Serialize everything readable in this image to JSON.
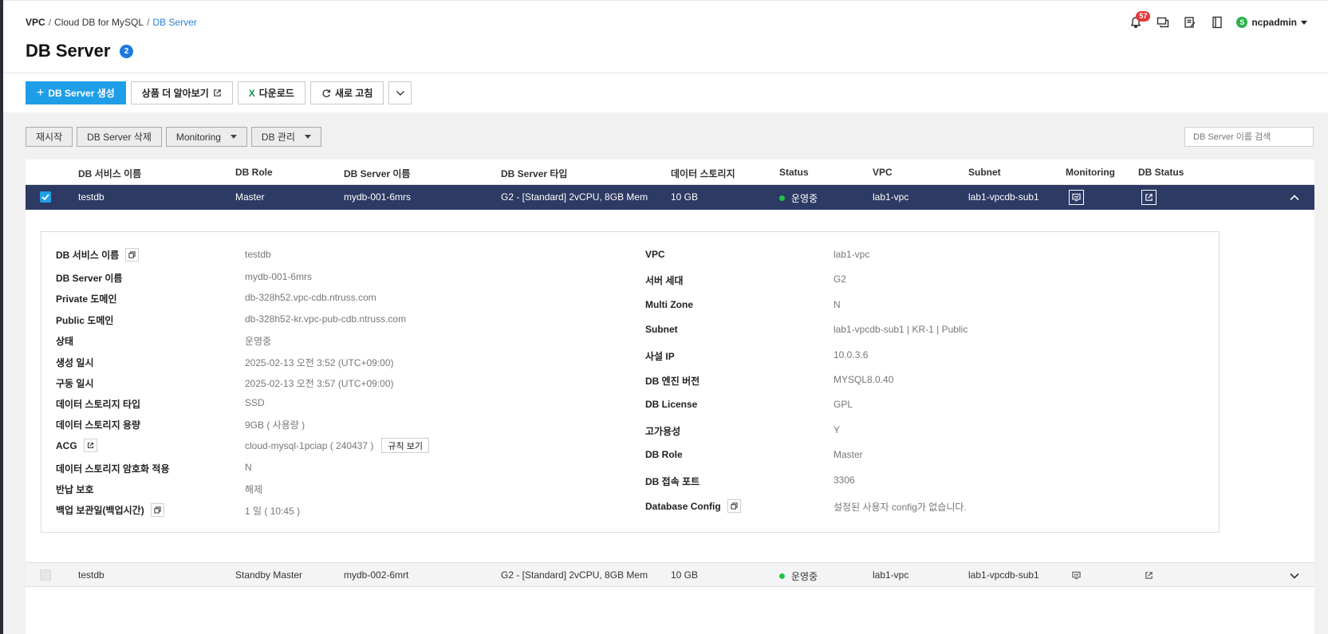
{
  "breadcrumb": {
    "root": "VPC",
    "sep": "/",
    "mid": "Cloud DB for MySQL",
    "current": "DB Server"
  },
  "page": {
    "title": "DB Server",
    "count": "2"
  },
  "topbar": {
    "notification_count": "57",
    "user_initial": "S",
    "user_name": "ncpadmin"
  },
  "toolbar": {
    "create_label": "DB Server 생성",
    "learn_more_label": "상품 더 알아보기",
    "download_label": "다운로드",
    "refresh_label": "새로 고침"
  },
  "actions": {
    "restart": "재시작",
    "delete": "DB Server 삭제",
    "monitoring": "Monitoring",
    "db_manage": "DB 관리"
  },
  "search": {
    "placeholder": "DB Server 이름 검색"
  },
  "table": {
    "headers": [
      "DB 서비스 이름",
      "DB Role",
      "DB Server 이름",
      "DB Server 타입",
      "데이터 스토리지",
      "Status",
      "VPC",
      "Subnet",
      "Monitoring",
      "DB Status"
    ],
    "rows": [
      {
        "service": "testdb",
        "role": "Master",
        "server": "mydb-001-6mrs",
        "type": "G2 - [Standard] 2vCPU, 8GB Mem",
        "storage": "10 GB",
        "status": "운영중",
        "vpc": "lab1-vpc",
        "subnet": "lab1-vpcdb-sub1"
      },
      {
        "service": "testdb",
        "role": "Standby Master",
        "server": "mydb-002-6mrt",
        "type": "G2 - [Standard] 2vCPU, 8GB Mem",
        "storage": "10 GB",
        "status": "운영중",
        "vpc": "lab1-vpc",
        "subnet": "lab1-vpcdb-sub1"
      }
    ]
  },
  "detail": {
    "left": [
      {
        "label": "DB 서비스 이름",
        "value": "testdb"
      },
      {
        "label": "DB Server 이름",
        "value": "mydb-001-6mrs"
      },
      {
        "label": "Private 도메인",
        "value": "db-328h52.vpc-cdb.ntruss.com"
      },
      {
        "label": "Public 도메인",
        "value": "db-328h52-kr.vpc-pub-cdb.ntruss.com"
      },
      {
        "label": "상태",
        "value": "운영중"
      },
      {
        "label": "생성 일시",
        "value": "2025-02-13 오전 3:52 (UTC+09:00)"
      },
      {
        "label": "구동 일시",
        "value": "2025-02-13 오전 3:57 (UTC+09:00)"
      },
      {
        "label": "데이터 스토리지 타입",
        "value": "SSD"
      },
      {
        "label": "데이터 스토리지 용량",
        "value": "9GB ( 사용량 )"
      },
      {
        "label": "ACG",
        "value": "cloud-mysql-1pciap ( 240437 )",
        "button": "규칙 보기"
      },
      {
        "label": "데이터 스토리지 암호화 적용",
        "value": "N"
      },
      {
        "label": "반납 보호",
        "value": "해제"
      },
      {
        "label": "백업 보관일(백업시간)",
        "value": "1 일 ( 10:45 )"
      }
    ],
    "right": [
      {
        "label": "VPC",
        "value": "lab1-vpc"
      },
      {
        "label": "서버 세대",
        "value": "G2"
      },
      {
        "label": "Multi Zone",
        "value": "N"
      },
      {
        "label": "Subnet",
        "value": "lab1-vpcdb-sub1 | KR-1 | Public"
      },
      {
        "label": "사설 IP",
        "value": "10.0.3.6"
      },
      {
        "label": "DB 엔진 버전",
        "value": "MYSQL8.0.40"
      },
      {
        "label": "DB License",
        "value": "GPL"
      },
      {
        "label": "고가용성",
        "value": "Y"
      },
      {
        "label": "DB Role",
        "value": "Master"
      },
      {
        "label": "DB 접속 포트",
        "value": "3306"
      },
      {
        "label": "Database Config",
        "value": "설정된 사용자 config가 없습니다."
      }
    ]
  },
  "colors": {
    "accent": "#1f9ee8",
    "selected_row": "#2d3a63",
    "status_ok": "#21c14a",
    "badge": "#e23b3b"
  }
}
